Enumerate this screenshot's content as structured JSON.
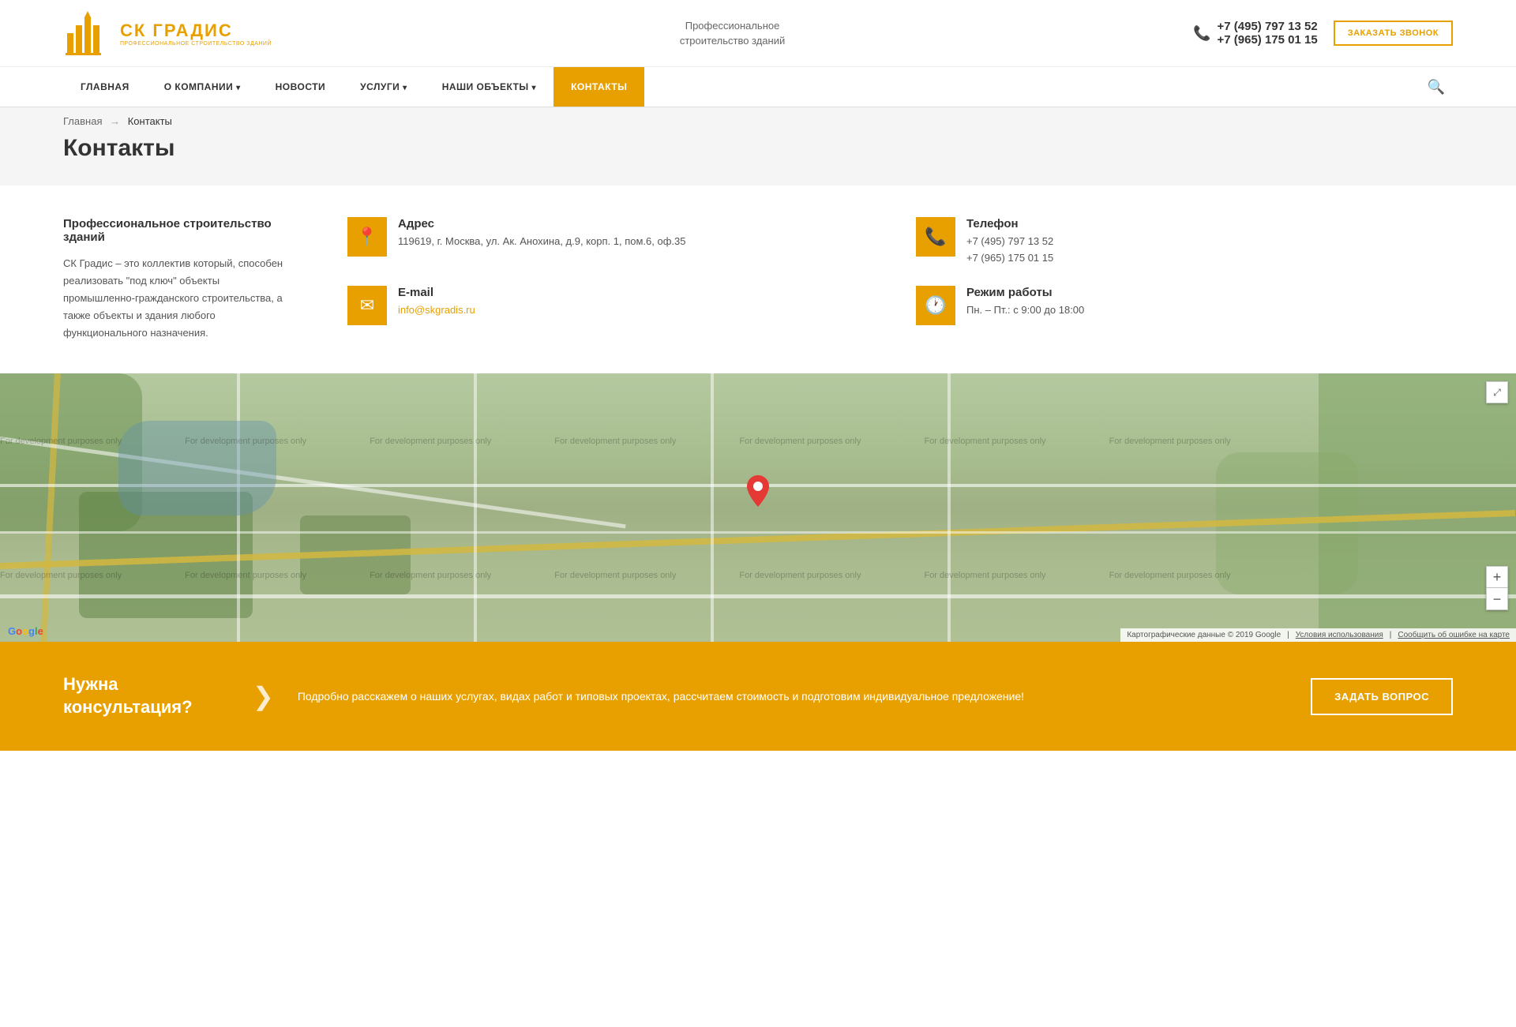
{
  "header": {
    "logo_title": "СК ГРАДИС",
    "logo_subtitle": "ПРОФЕССИОНАЛЬНОЕ СТРОИТЕЛЬСТВО ЗДАНИЙ",
    "slogan_line1": "Профессиональное",
    "slogan_line2": "строительство зданий",
    "phone1": "+7 (495) 797 13 52",
    "phone2": "+7 (965) 175 01 15",
    "order_call_btn": "ЗАКАЗАТЬ ЗВОНОК"
  },
  "nav": {
    "items": [
      {
        "label": "ГЛАВНАЯ",
        "active": false,
        "has_arrow": false
      },
      {
        "label": "О КОМПАНИИ",
        "active": false,
        "has_arrow": true
      },
      {
        "label": "НОВОСТИ",
        "active": false,
        "has_arrow": false
      },
      {
        "label": "УСЛУГИ",
        "active": false,
        "has_arrow": true
      },
      {
        "label": "НАШИ ОБЪЕКТЫ",
        "active": false,
        "has_arrow": true
      },
      {
        "label": "КОНТАКТЫ",
        "active": true,
        "has_arrow": false
      }
    ]
  },
  "breadcrumb": {
    "home": "Главная",
    "separator": "→",
    "current": "Контакты"
  },
  "page": {
    "title": "Контакты"
  },
  "contacts_left": {
    "heading": "Профессиональное строительство зданий",
    "description": "СК Градис – это коллектив который, способен реализовать \"под ключ\" объекты промышленно-гражданского строительства, а также объекты и здания любого функционального назначения."
  },
  "contact_cards": [
    {
      "icon": "📍",
      "label": "Адрес",
      "value": "119619, г. Москва, ул. Ак. Анохина, д.9, корп. 1, пом.6, оф.35"
    },
    {
      "icon": "📞",
      "label": "Телефон",
      "value": "+7 (495) 797 13 52\n+7 (965) 175 01 15"
    },
    {
      "icon": "✉",
      "label": "E-mail",
      "value": "info@skgradis.ru"
    },
    {
      "icon": "🕐",
      "label": "Режим работы",
      "value": "Пн. – Пт.: с 9:00 до 18:00"
    }
  ],
  "map": {
    "watermark": "For development purposes only",
    "map_footer": "Картографические данные © 2019 Google",
    "terms": "Условия использования",
    "report": "Сообщить об ошибке на карте",
    "zoom_in": "+",
    "zoom_out": "−"
  },
  "cta": {
    "title": "Нужна консультация?",
    "arrow": "❯",
    "description": "Подробно расскажем о наших услугах, видах работ и типовых проектах, рассчитаем стоимость и подготовим индивидуальное предложение!",
    "button_label": "ЗАДАТЬ ВОПРОС"
  }
}
